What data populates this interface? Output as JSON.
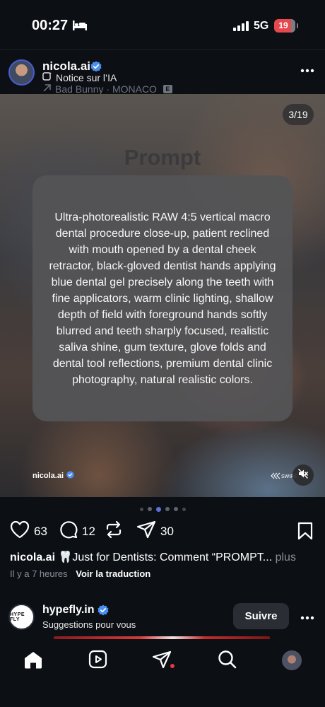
{
  "status": {
    "time": "00:27",
    "network": "5G",
    "battery": "19",
    "icons": [
      "bed-icon",
      "signal-icon",
      "battery-icon"
    ]
  },
  "post": {
    "username": "nicola.ai",
    "ai_label": "Notice sur l’IA",
    "audio": "Bad Bunny · MONACO",
    "audio_badge": "E",
    "counter": "3/19",
    "slide_title": "Prompt",
    "prompt_text": "Ultra-photorealistic RAW 4:5 vertical macro dental procedure close-up, patient reclined with mouth opened by a dental cheek retractor, black-gloved dentist hands applying blue dental gel precisely along the teeth with fine applicators, warm clinic lighting, shallow depth of field with foreground hands softly blurred and teeth sharply focused, realistic saliva shine, gum texture, glove folds and dental tool reflections, premium dental clinic photography, natural realistic colors.",
    "watermark": "nicola.ai",
    "swipe_label": "SWIPE",
    "likes": "63",
    "comments": "12",
    "shares": "30",
    "caption_user": "nicola.ai",
    "caption_text": "🦷Just for Dentists: Comment “PROMPT...",
    "caption_more": "plus",
    "time_ago": "Il y a 7 heures",
    "translate": "Voir la traduction",
    "accent_color": "#4a90f0"
  },
  "next_post": {
    "username": "hypefly.in",
    "subtitle": "Suggestions pour vous",
    "follow_label": "Suivre",
    "avatar_text": "HYPE FLY"
  },
  "nav": {
    "items": [
      "home-icon",
      "reels-icon",
      "messages-icon",
      "search-icon",
      "profile-avatar"
    ]
  }
}
